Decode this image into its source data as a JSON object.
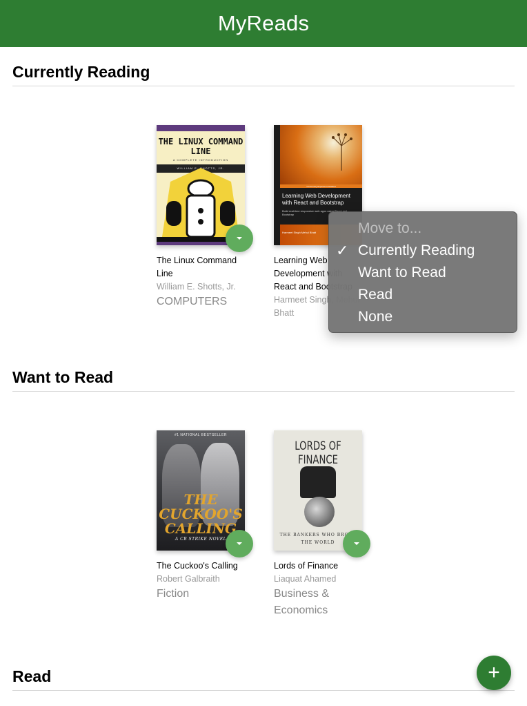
{
  "header": {
    "title": "MyReads"
  },
  "shelves": [
    {
      "title": "Currently Reading",
      "books": [
        {
          "title": "The Linux Command Line",
          "authors": "William E. Shotts, Jr.",
          "category": "COMPUTERS",
          "cover": {
            "title": "THE LINUX COMMAND LINE",
            "subtitle": "A COMPLETE INTRODUCTION",
            "author": "WILLIAM E. SHOTTS, JR."
          }
        },
        {
          "title": "Learning Web Development with React and Bootstrap",
          "authors": "Harmeet Singh, Mehul Bhatt",
          "cover": {
            "publisher": "Community Experience Distilled",
            "title": "Learning Web Development with React and Bootstrap",
            "subtitle": "Build real-time responsive web apps using React and Bootstrap",
            "author": "Harmeet Singh Mehul Bhatt"
          }
        }
      ]
    },
    {
      "title": "Want to Read",
      "books": [
        {
          "title": "The Cuckoo's Calling",
          "authors": "Robert Galbraith",
          "category": "Fiction",
          "cover": {
            "top": "#1 NATIONAL BESTSELLER",
            "title": "THE CUCKOO'S CALLING",
            "subtitle": "A CB STRIKE NOVEL"
          }
        },
        {
          "title": "Lords of Finance",
          "authors": "Liaquat Ahamed",
          "category": "Business & Economics",
          "cover": {
            "title": "LORDS OF FINANCE",
            "subtitle": "THE BANKERS WHO BROKE THE WORLD"
          }
        }
      ]
    },
    {
      "title": "Read",
      "books": []
    }
  ],
  "menu": {
    "header": "Move to...",
    "check_glyph": "✓",
    "options": [
      "Currently Reading",
      "Want to Read",
      "Read",
      "None"
    ],
    "selected": "Currently Reading"
  },
  "fab": {
    "label": "+"
  },
  "colors": {
    "header_bg": "#2e7d32",
    "changer_bg": "#60ac5d",
    "fab_bg": "#2e7d32"
  }
}
